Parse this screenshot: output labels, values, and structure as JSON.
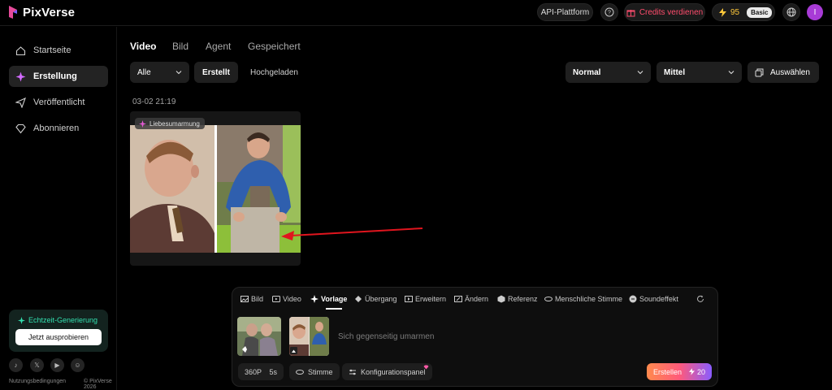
{
  "brand": {
    "name": "PixVerse"
  },
  "topbar": {
    "api_label": "API-Plattform",
    "credits_label": "Credits verdienen",
    "credits_count": "95",
    "plan_badge": "Basic",
    "avatar_initial": "I"
  },
  "sidebar": {
    "items": [
      {
        "label": "Startseite",
        "icon": "home-icon"
      },
      {
        "label": "Erstellung",
        "icon": "sparkle-icon"
      },
      {
        "label": "Veröffentlicht",
        "icon": "send-icon"
      },
      {
        "label": "Abonnieren",
        "icon": "diamond-icon"
      }
    ],
    "promo": {
      "title": "Echtzeit-Generierung",
      "button": "Jetzt ausprobieren"
    },
    "footer": {
      "terms": "Nutzungsbedingungen",
      "copyright": "© PixVerse 2026"
    }
  },
  "main": {
    "tabs": [
      "Video",
      "Bild",
      "Agent",
      "Gespeichert"
    ],
    "active_tab": "Video",
    "filters": {
      "scope": "Alle",
      "created": "Erstellt",
      "uploaded": "Hochgeladen",
      "quality": "Normal",
      "size": "Mittel",
      "select": "Auswählen"
    },
    "date_group": "03-02 21:19",
    "card": {
      "tag": "Liebesumarmung"
    }
  },
  "prompt_panel": {
    "tabs": [
      "Bild",
      "Video",
      "Vorlage",
      "Übergang",
      "Erweitern",
      "Ändern",
      "Referenz",
      "Menschliche Stimme",
      "Soundeffekt"
    ],
    "active_tab": "Vorlage",
    "prompt": "Sich gegenseitig umarmen",
    "resolution": "360P",
    "duration": "5s",
    "voice": "Stimme",
    "config": "Konfigurationspanel",
    "create_label": "Erstellen",
    "create_cost": "20"
  },
  "colors": {
    "accent_pink": "#ff4d6d",
    "promo_green": "#33e0b0",
    "avatar": "#a83bd6"
  }
}
